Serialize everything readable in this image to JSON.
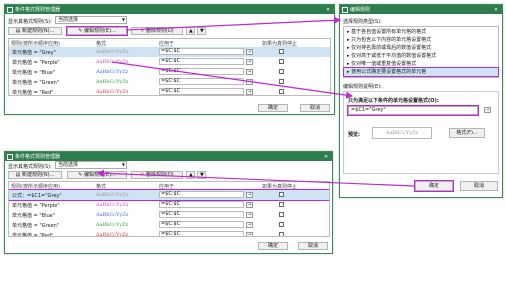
{
  "mgr1": {
    "title": "条件格式规则管理器",
    "show_label": "显示其格式规则(S):",
    "show_value": "当前选择",
    "new_rule": "新建规则(N)...",
    "edit_rule": "编辑规则(E)...",
    "delete_rule": "删除规则(D)",
    "col_rule": "规则(按所示顺序应用)",
    "col_format": "格式",
    "col_applies": "应用于",
    "col_stop": "如果为真则停止",
    "rows": [
      {
        "rule": "单元格值 = \"Grey\"",
        "format": "AaBbCcYyZz",
        "applies": "=$C:$C",
        "color": "#9a9a9a"
      },
      {
        "rule": "单元格值 = \"Perple\"",
        "format": "AaBbCcYyZz",
        "applies": "=$C:$C",
        "color": "#c84fc8"
      },
      {
        "rule": "单元格值 = \"Blue\"",
        "format": "AaBbCcYyZz",
        "applies": "=$C:$C",
        "color": "#3a6fd8"
      },
      {
        "rule": "单元格值 = \"Green\"",
        "format": "AaBbCcYyZz",
        "applies": "=$C:$C",
        "color": "#2e9e3e"
      },
      {
        "rule": "单元格值 = \"Red\"",
        "format": "AaBbCcYyZz",
        "applies": "=$C:$C",
        "color": "#d83a3a"
      }
    ],
    "ok": "确定",
    "cancel": "取消"
  },
  "mgr2": {
    "title": "条件格式规则管理器",
    "show_label": "显示其格式规则(S):",
    "show_value": "当前选择",
    "new_rule": "新建规则(N)...",
    "edit_rule": "编辑规则(E)...",
    "delete_rule": "删除规则(D)",
    "col_rule": "规则(按所示顺序应用)",
    "col_format": "格式",
    "col_applies": "应用于",
    "col_stop": "如果为真则停止",
    "rows": [
      {
        "rule": "公式：=$C1=\"Grey\"",
        "format": "AaBbCcYyZz",
        "applies": "=$C:$C",
        "color": "#9a9a9a"
      },
      {
        "rule": "单元格值 = \"Perple\"",
        "format": "AaBbCcYyZz",
        "applies": "=$C:$C",
        "color": "#c84fc8"
      },
      {
        "rule": "单元格值 = \"Blue\"",
        "format": "AaBbCcYyZz",
        "applies": "=$C:$C",
        "color": "#3a6fd8"
      },
      {
        "rule": "单元格值 = \"Green\"",
        "format": "AaBbCcYyZz",
        "applies": "=$C:$C",
        "color": "#2e9e3e"
      },
      {
        "rule": "单元格值 = \"Red\"",
        "format": "AaBbCcYyZz",
        "applies": "=$C:$C",
        "color": "#d83a3a"
      }
    ],
    "ok": "确定",
    "cancel": "取消"
  },
  "edit": {
    "title": "编辑规则",
    "select_type": "选择规则类型(S):",
    "types": [
      "基于各自值设置所有单元格的格式",
      "只为包含以下内容的单元格设置格式",
      "仅对排名靠前或靠后的数值设置格式",
      "仅对高于或低于平均值的数值设置格式",
      "仅对唯一值或重复值设置格式",
      "使用公式确定要设置格式的单元格"
    ],
    "edit_desc": "编辑规则说明(E):",
    "formula_label": "只为满足以下条件的单元格设置格式(O):",
    "formula_value": "=$C1=\"Grey\"",
    "preview_label": "预览:",
    "preview_sample": "AaBbCcYyZz",
    "format_btn": "格式(F)...",
    "ok": "确定",
    "cancel": "取消"
  },
  "colors": {
    "title_green": "#2e7d4f",
    "highlight": "#c026d3",
    "selected_row": "#cfe3f5"
  }
}
